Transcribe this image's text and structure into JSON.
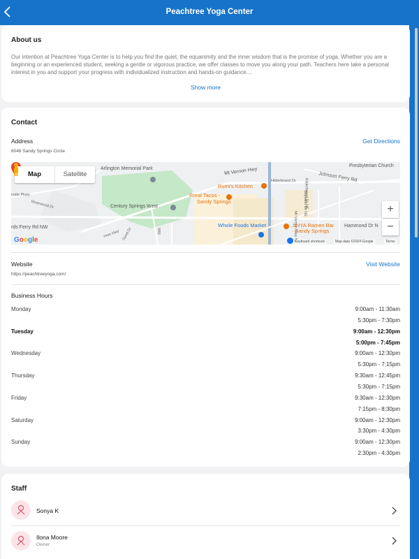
{
  "header": {
    "title": "Peachtree Yoga Center",
    "back_icon": "chevron-left-icon"
  },
  "about": {
    "heading": "About us",
    "text": "Our intention at Peachtree Yoga Center is to help you find the quiet, the equanimity and the inner wisdom that is the promise of yoga. Whether you are a beginning or an experienced student, seeking a gentle or vigorous practice, we offer classes to move you along your path. Teachers here take a personal interest in you and support your progress with individualized instruction and hands-on guidance....",
    "show_more": "Show more"
  },
  "contact": {
    "heading": "Contact",
    "address_label": "Address",
    "address_value": "6046 Sandy Springs Circle",
    "directions_link": "Get Directions",
    "map": {
      "tab_map": "Map",
      "tab_satellite": "Satellite",
      "labels": {
        "arlington": "Arlington Memorial Park",
        "mt_vernon": "Mt Vernon Hwy",
        "presbyterian": "Presbyterian Church",
        "johnson_ferry": "Johnson Ferry Rd",
        "rumis": "Rumi's Kitchen",
        "hilderbrand": "Hilderbrand Dr",
        "rreal_tacos_1": "Rreal Tacos -",
        "rreal_tacos_2": "Sandy Springs",
        "century_springs": "Century Springs West",
        "wholefoods": "Whole Foods Market",
        "jinya_1": "JINYA Ramen Bar",
        "jinya_2": "- Sandy Springs",
        "hammond": "Hammond Dr N",
        "riverwood": "Riverwood Dr",
        "ferry_rd": "rds Ferry Rd NW",
        "mt_vernon_lower": "rnon Hwy",
        "pkwy": "rside Pkwy",
        "sand_dr": "Sand Dr",
        "mw": "MW",
        "boylston": "Boylston Dr NE",
        "hilderbrand_ne": "Hilderbrand Dr NE",
        "mt_vernon_ne": "Mt Vernon Hwy NE"
      },
      "footer_shortcuts": "Keyboard shortcuts",
      "footer_data": "Map data ©2024 Google",
      "footer_terms": "Terms",
      "logo": "Google",
      "zoom_in": "+",
      "zoom_out": "−"
    },
    "website_label": "Website",
    "website_value": "https://peachtreeyoga.com/",
    "website_link": "Visit Website",
    "hours_heading": "Business Hours",
    "hours": [
      {
        "day": "Monday",
        "times": [
          "9:00am - 11:30am",
          "5:30pm - 7:30pm"
        ],
        "today": false
      },
      {
        "day": "Tuesday",
        "times": [
          "9:00am - 12:30pm",
          "5:00pm - 7:45pm"
        ],
        "today": true
      },
      {
        "day": "Wednesday",
        "times": [
          "9:00am - 12:30pm",
          "5:30pm - 7:15pm"
        ],
        "today": false
      },
      {
        "day": "Thursday",
        "times": [
          "9:30am - 12:45pm",
          "5:30pm - 7:15pm"
        ],
        "today": false
      },
      {
        "day": "Friday",
        "times": [
          "9:30am - 12:30pm",
          "7:15pm - 8:30pm"
        ],
        "today": false
      },
      {
        "day": "Saturday",
        "times": [
          "9:00am - 12:30pm",
          "3:30pm - 4:30pm"
        ],
        "today": false
      },
      {
        "day": "Sunday",
        "times": [
          "9:00am - 12:30pm",
          "2:30pm - 4:30pm"
        ],
        "today": false
      }
    ]
  },
  "staff": {
    "heading": "Staff",
    "members": [
      {
        "name": "Sonya K",
        "role": ""
      },
      {
        "name": "Ilona Moore",
        "role": "Owner"
      }
    ]
  },
  "colors": {
    "accent": "#1673c9",
    "avatar_bg": "#fbe4e7",
    "avatar_icon": "#d9546a"
  }
}
